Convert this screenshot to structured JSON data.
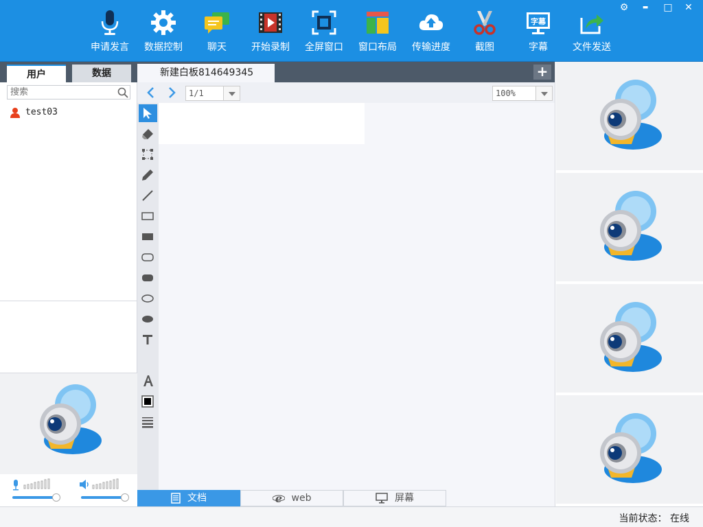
{
  "toolbar": {
    "items": [
      {
        "label": "申请发言",
        "icon": "microphone-icon"
      },
      {
        "label": "数据控制",
        "icon": "gear-icon"
      },
      {
        "label": "聊天",
        "icon": "chat-bubbles-icon"
      },
      {
        "label": "开始录制",
        "icon": "film-record-icon"
      },
      {
        "label": "全屏窗口",
        "icon": "fullscreen-icon"
      },
      {
        "label": "窗口布局",
        "icon": "layout-icon"
      },
      {
        "label": "传输进度",
        "icon": "cloud-upload-icon"
      },
      {
        "label": "截图",
        "icon": "scissors-icon"
      },
      {
        "label": "字幕",
        "icon": "subtitle-icon",
        "badge": "字幕"
      },
      {
        "label": "文件发送",
        "icon": "file-send-icon"
      }
    ],
    "window_controls": {
      "settings": "⚙",
      "minimize": "▬",
      "maximize": "□",
      "close": "✕"
    }
  },
  "left_panel": {
    "tabs": [
      {
        "label": "用户",
        "active": true
      },
      {
        "label": "数据",
        "active": false
      }
    ],
    "search_placeholder": "搜索",
    "users": [
      {
        "name": "test03",
        "icon": "user-icon"
      }
    ]
  },
  "whiteboard": {
    "tab_title": "新建白板814649345",
    "add_tab_label": "+",
    "page": "1/1",
    "zoom": "100%",
    "tools": [
      "select",
      "eraser",
      "region-select",
      "pen",
      "line",
      "rectangle",
      "filled-rectangle",
      "rounded-rectangle",
      "filled-rounded-rectangle",
      "ellipse",
      "filled-ellipse",
      "text",
      "font",
      "color",
      "line-width"
    ],
    "selected_tool": "select"
  },
  "bottom_tabs": [
    {
      "label": "文档",
      "active": true,
      "icon": "document-icon"
    },
    {
      "label": "web",
      "active": false,
      "icon": "ie-icon"
    },
    {
      "label": "屏幕",
      "active": false,
      "icon": "monitor-icon"
    }
  ],
  "video_slots": 4,
  "status": {
    "text": "当前状态： 在线"
  },
  "colors": {
    "toolbar_bg": "#1c8fe3",
    "tab_bar_bg": "#4d5a69",
    "accent": "#3a98e6",
    "user_icon": "#e8401c"
  }
}
